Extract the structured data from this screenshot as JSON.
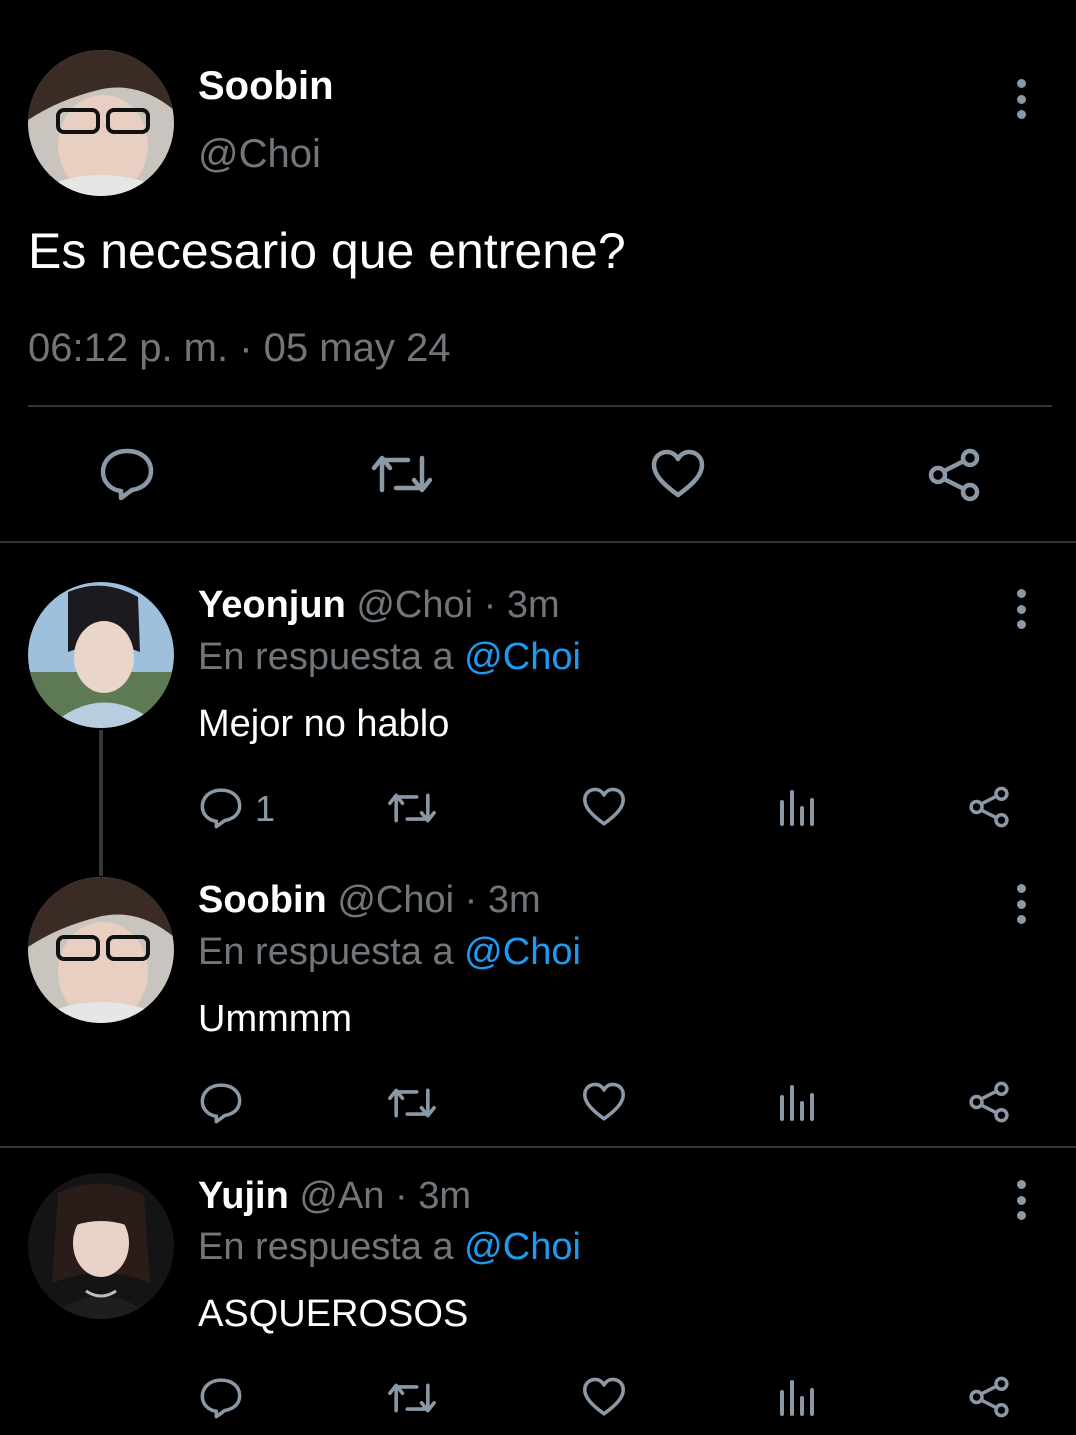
{
  "main_tweet": {
    "name": "Soobin",
    "handle": "@Choi",
    "text": "Es necesario que entrene?",
    "timestamp": "06:12 p. m. · 05 may 24",
    "actions": [
      "reply-icon",
      "retweet-icon",
      "like-icon",
      "share-icon"
    ]
  },
  "replies": [
    {
      "name": "Yeonjun",
      "handle": "@Choi",
      "sep": "·",
      "time": "3m",
      "reply_prefix": "En respuesta a",
      "reply_to": "@Choi",
      "text": "Mejor no hablo",
      "reply_count": "1"
    },
    {
      "name": "Soobin",
      "handle": "@Choi",
      "sep": "·",
      "time": "3m",
      "reply_prefix": "En respuesta a",
      "reply_to": "@Choi",
      "text": "Ummmm",
      "reply_count": ""
    },
    {
      "name": "Yujin",
      "handle": "@An",
      "sep": "·",
      "time": "3m",
      "reply_prefix": "En respuesta a",
      "reply_to": "@Choi",
      "text": "ASQUEROSOS",
      "reply_count": ""
    }
  ],
  "colors": {
    "background": "#000000",
    "text": "#e7e9ea",
    "muted": "#71767b",
    "link": "#1d9bf0",
    "icon": "#8b98a5",
    "divider": "#2f3336"
  }
}
